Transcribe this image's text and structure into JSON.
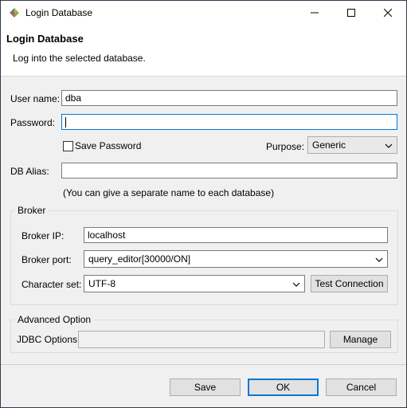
{
  "window": {
    "title": "Login Database",
    "icon": "cubrid-logo-icon",
    "controls": [
      "minimize-icon",
      "maximize-icon",
      "close-icon"
    ]
  },
  "header": {
    "title": "Login Database",
    "description": "Log into the selected database."
  },
  "form": {
    "username_label": "User name:",
    "username_value": "dba",
    "password_label": "Password:",
    "password_value": "",
    "save_password_label": "Save Password",
    "save_password_checked": false,
    "purpose_label": "Purpose:",
    "purpose_value": "Generic",
    "db_alias_label": "DB Alias:",
    "db_alias_value": "",
    "db_alias_hint": "(You can give a separate name to each database)"
  },
  "broker": {
    "group_title": "Broker",
    "ip_label": "Broker IP:",
    "ip_value": "localhost",
    "port_label": "Broker port:",
    "port_value": "query_editor[30000/ON]",
    "charset_label": "Character set:",
    "charset_value": "UTF-8",
    "test_connection_label": "Test Connection"
  },
  "advanced": {
    "group_title": "Advanced Option",
    "jdbc_label": "JDBC Options",
    "jdbc_value": "",
    "manage_label": "Manage"
  },
  "footer": {
    "save_label": "Save",
    "ok_label": "OK",
    "cancel_label": "Cancel"
  },
  "colors": {
    "focus_border": "#0078d7",
    "background": "#f0f0f0"
  }
}
